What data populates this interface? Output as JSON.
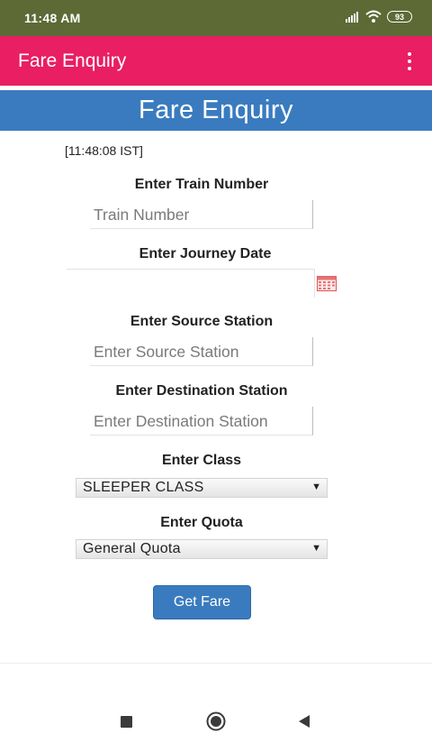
{
  "status_bar": {
    "time": "11:48 AM",
    "battery": "93",
    "icons": [
      "signal-icon",
      "wifi-icon",
      "battery-icon"
    ]
  },
  "app_bar": {
    "title": "Fare Enquiry",
    "menu_icon": "more-vert-icon"
  },
  "banner": {
    "title": "Fare Enquiry"
  },
  "form": {
    "timestamp": "[11:48:08 IST]",
    "train_number": {
      "label": "Enter Train Number",
      "placeholder": "Train Number",
      "value": ""
    },
    "journey_date": {
      "label": "Enter Journey Date",
      "value": "",
      "icon": "calendar-icon"
    },
    "source_station": {
      "label": "Enter Source Station",
      "placeholder": "Enter Source Station",
      "value": ""
    },
    "destination_station": {
      "label": "Enter Destination Station",
      "placeholder": "Enter Destination Station",
      "value": ""
    },
    "travel_class": {
      "label": "Enter Class",
      "selected": "SLEEPER CLASS"
    },
    "quota": {
      "label": "Enter Quota",
      "selected": "General Quota"
    },
    "submit_label": "Get Fare"
  },
  "colors": {
    "status_bar": "#5d6a36",
    "app_bar": "#e91e63",
    "banner": "#3a7bbf",
    "button": "#3a7bbf"
  },
  "nav_bar": {
    "icons": [
      "recents-square-icon",
      "home-circle-icon",
      "back-triangle-icon"
    ]
  }
}
